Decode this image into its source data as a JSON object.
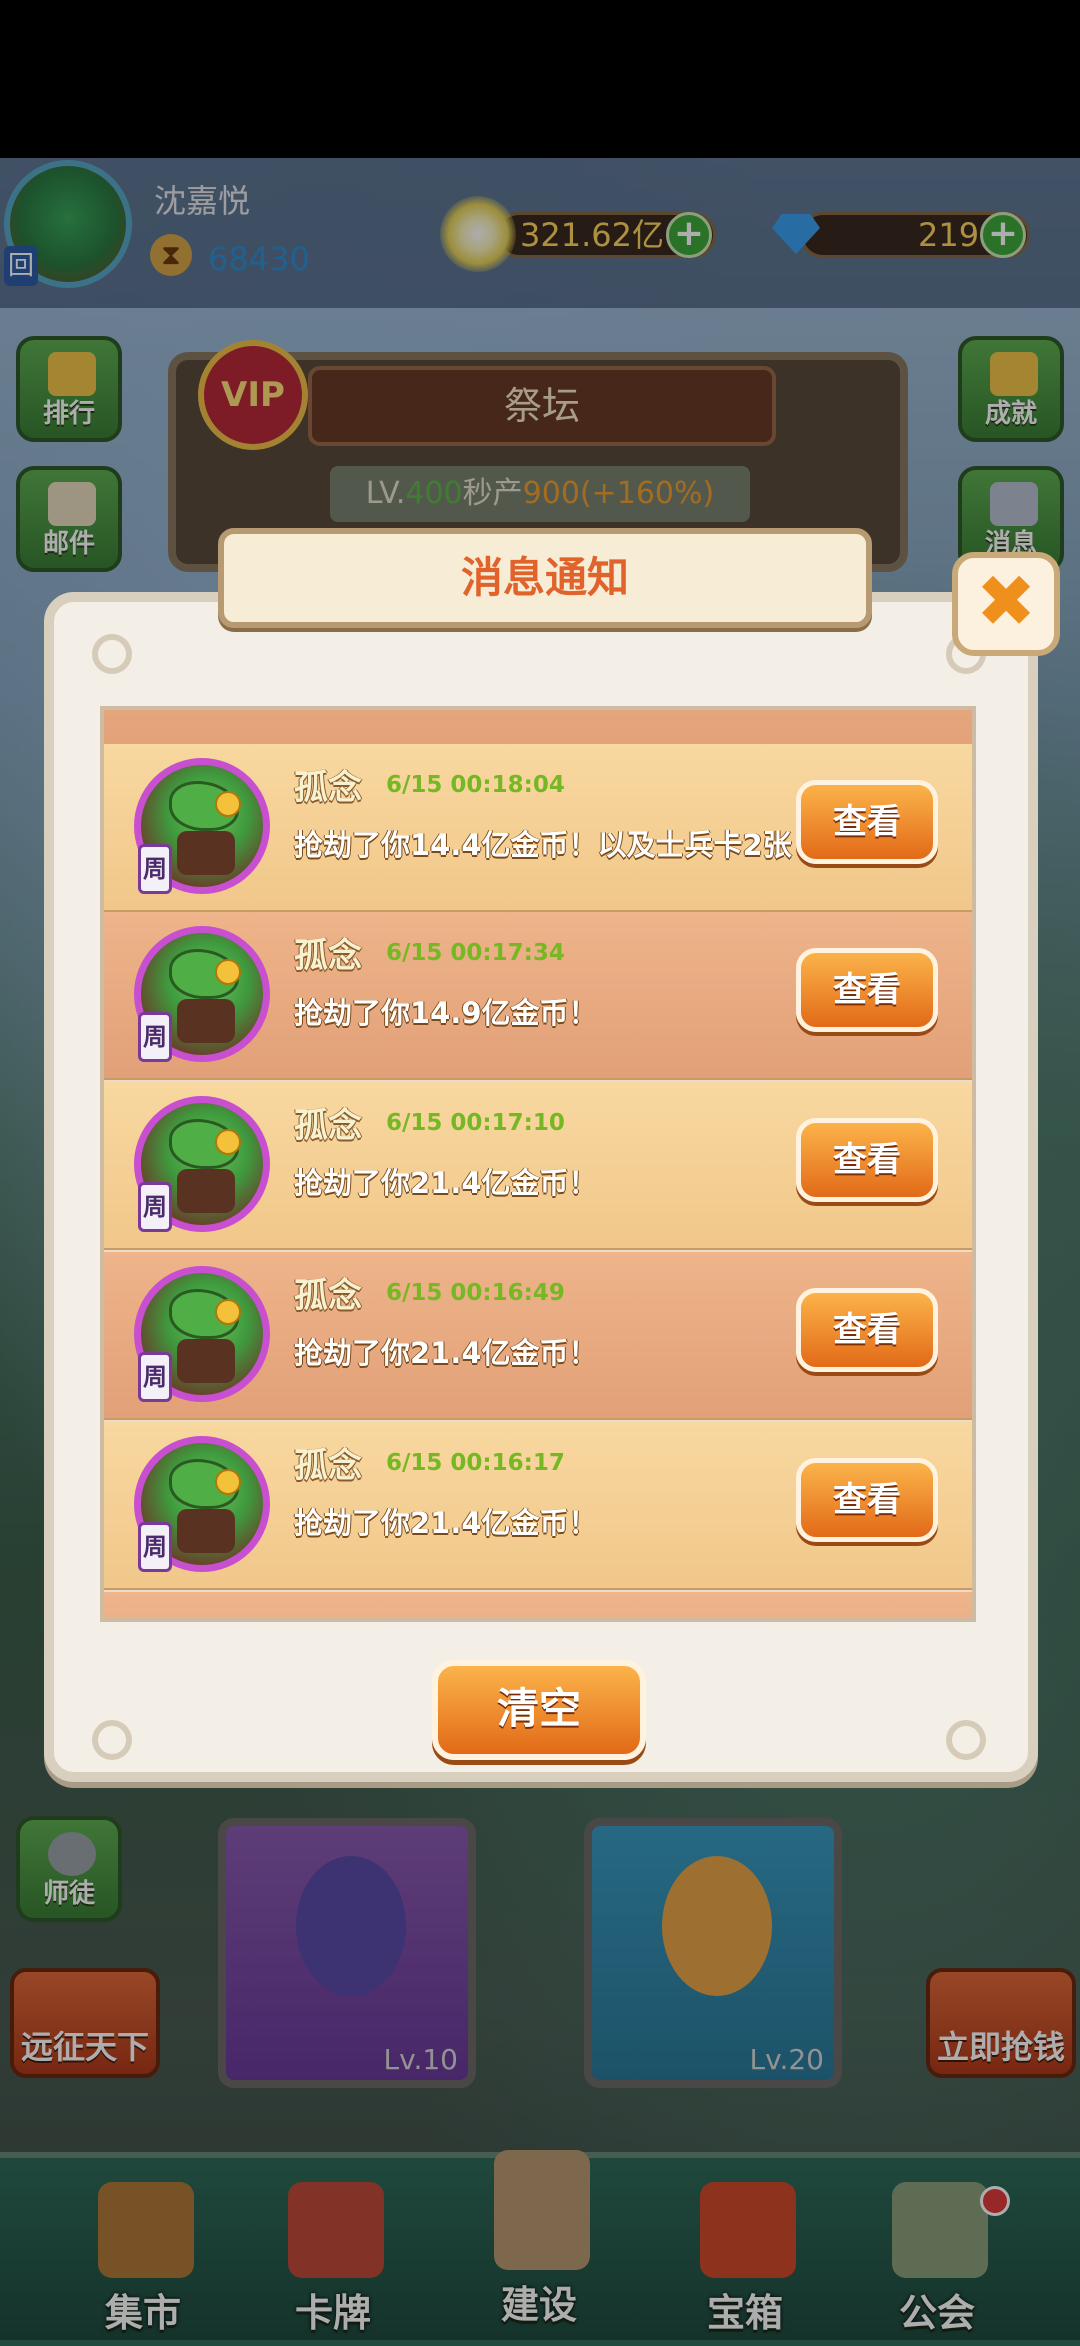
{
  "player": {
    "name": "沈嘉悦",
    "power": "68430",
    "avatar_badge": "回"
  },
  "resources": {
    "gold": "321.62亿",
    "gems": "219",
    "plus": "+"
  },
  "side_buttons": {
    "rank": "排行",
    "mail": "邮件",
    "achievement": "成就",
    "message": "消息",
    "mentor": "师徒",
    "expedition": "远征天下",
    "rob": "立即抢钱"
  },
  "altar": {
    "vip": "VIP",
    "title": "祭坛",
    "level_label": "LV.",
    "level_value": "400",
    "prod_label": "秒产",
    "prod_value": "900(+160%)"
  },
  "cards": [
    {
      "level": "Lv.10"
    },
    {
      "level": "Lv.20"
    }
  ],
  "modal": {
    "title": "消息通知",
    "close_icon": "✖",
    "view_label": "查看",
    "clear_label": "清空",
    "week_tag": "周",
    "messages": [
      {
        "name": "孤念",
        "time": "6/15 00:18:04",
        "text": "抢劫了你14.4亿金币！以及士兵卡2张"
      },
      {
        "name": "孤念",
        "time": "6/15 00:17:34",
        "text": "抢劫了你14.9亿金币！"
      },
      {
        "name": "孤念",
        "time": "6/15 00:17:10",
        "text": "抢劫了你21.4亿金币！"
      },
      {
        "name": "孤念",
        "time": "6/15 00:16:49",
        "text": "抢劫了你21.4亿金币！"
      },
      {
        "name": "孤念",
        "time": "6/15 00:16:17",
        "text": "抢劫了你21.4亿金币！"
      }
    ]
  },
  "bottom_nav": [
    {
      "label": "集市",
      "icon": "market-icon"
    },
    {
      "label": "卡牌",
      "icon": "cards-icon"
    },
    {
      "label": "建设",
      "icon": "tower-icon"
    },
    {
      "label": "宝箱",
      "icon": "chest-icon"
    },
    {
      "label": "公会",
      "icon": "guild-icon"
    }
  ],
  "colors": {
    "accent_orange": "#e26a18",
    "title_orange": "#e0632c",
    "time_green": "#76b824",
    "avatar_ring": "#c74fd0"
  }
}
